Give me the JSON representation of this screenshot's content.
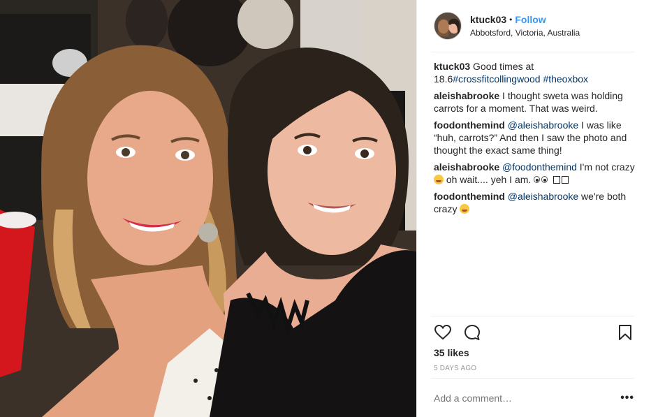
{
  "post": {
    "username": "ktuck03",
    "separator": "•",
    "follow_label": "Follow",
    "location": "Abbotsford, Victoria, Australia",
    "likes": "35 likes",
    "timestamp": "5 DAYS AGO",
    "comment_placeholder": "Add a comment…",
    "more_label": "•••"
  },
  "comments": [
    {
      "user": "ktuck03",
      "text_before": " Good times at 18.6",
      "tag1": "#crossfitcollingwood",
      "mid": " ",
      "tag2": "#theoxbox"
    },
    {
      "user": "aleishabrooke",
      "text": " I thought sweta was holding carrots for a moment. That was weird."
    },
    {
      "user": "foodonthemind",
      "mention": "@aleishabrooke",
      "text": " I was like “huh, carrots?” And then I saw the photo and thought the exact same thing!"
    },
    {
      "user": "aleishabrooke",
      "mention": "@foodonthemind",
      "text_a": " I'm not crazy ",
      "text_b": " oh wait.... yeh I am."
    },
    {
      "user": "foodonthemind",
      "mention": "@aleishabrooke",
      "text": " we're both crazy "
    }
  ],
  "icons": {
    "like": "heart-icon",
    "comment": "comment-bubble-icon",
    "save": "bookmark-icon"
  },
  "colors": {
    "follow": "#3897f0",
    "hashtag": "#003569",
    "muted": "#999999",
    "border": "#efefef"
  }
}
